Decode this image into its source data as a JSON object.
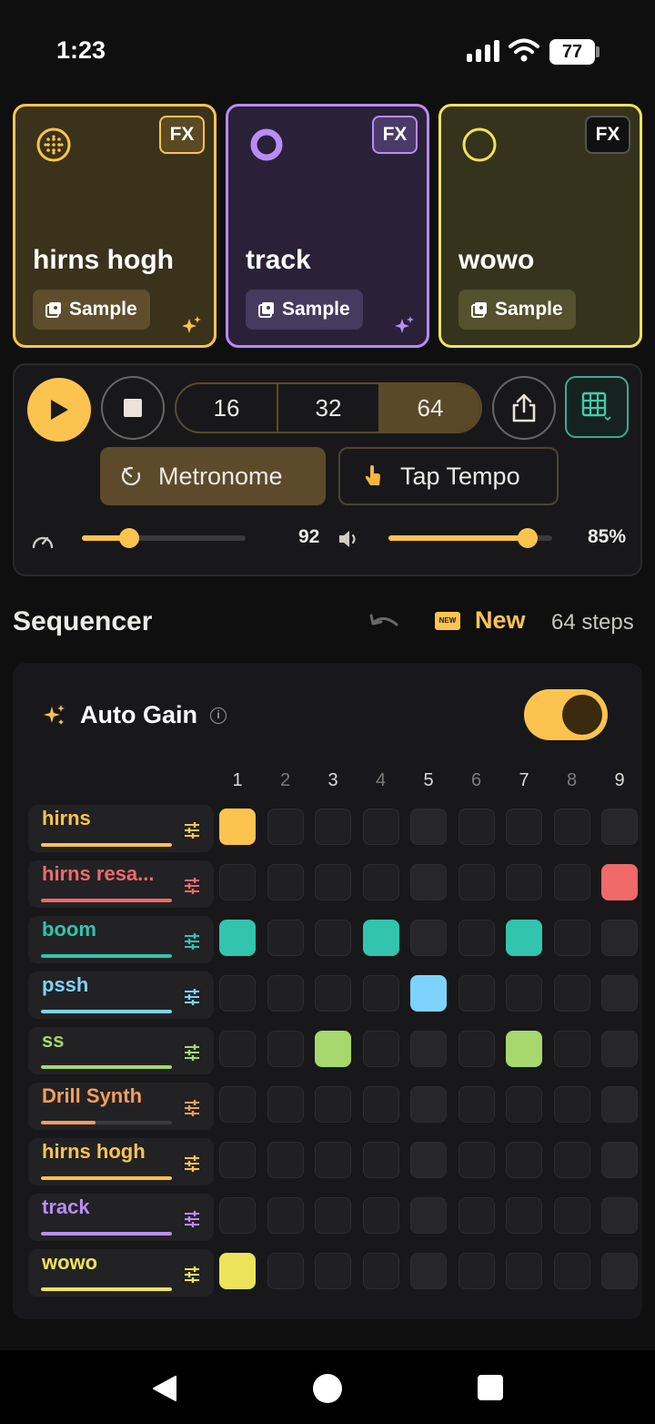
{
  "status_bar": {
    "time": "1:23",
    "battery": "77"
  },
  "tracks": [
    {
      "name": "hirns hogh",
      "fx_label": "FX",
      "sample_label": "Sample",
      "color": "#fcc44e",
      "bg": "#3b321b",
      "fx_bg": "#5a4a24",
      "chip_bg": "#5e4e2c",
      "icon": "dotted-circle-icon",
      "sparkle": true
    },
    {
      "name": "track",
      "fx_label": "FX",
      "sample_label": "Sample",
      "color": "#b98cf6",
      "bg": "#2a2138",
      "fx_bg": "#4a3a6a",
      "chip_bg": "#463a5e",
      "icon": "ring-icon",
      "sparkle": true
    },
    {
      "name": "wowo",
      "fx_label": "FX",
      "sample_label": "Sample",
      "color": "#ede45c",
      "bg": "#35331c",
      "fx_bg": "#111111",
      "chip_bg": "#55502d",
      "icon": "circle-outline-icon",
      "sparkle": false
    }
  ],
  "transport": {
    "step_options": [
      "16",
      "32",
      "64"
    ],
    "selected_steps": "64",
    "metronome_label": "Metronome",
    "tap_tempo_label": "Tap Tempo",
    "tempo": {
      "value": "92",
      "fraction": 0.29
    },
    "volume": {
      "value": "85%",
      "fraction": 0.85
    }
  },
  "sequencer": {
    "title": "Sequencer",
    "new_label": "New",
    "new_badge": "NEW",
    "steps_label": "64 steps",
    "auto_gain_label": "Auto Gain",
    "auto_gain_on": true,
    "step_numbers": [
      "1",
      "2",
      "3",
      "4",
      "5",
      "6",
      "7",
      "8",
      "9"
    ],
    "rows": [
      {
        "name": "hirns",
        "color": "#fcc44e",
        "level": 1.0,
        "active_steps": [
          1
        ]
      },
      {
        "name": "hirns resa...",
        "color": "#f06a6a",
        "level": 1.0,
        "active_steps": [
          9
        ]
      },
      {
        "name": "boom",
        "color": "#33c4ad",
        "level": 1.0,
        "active_steps": [
          1,
          4,
          7
        ]
      },
      {
        "name": "pssh",
        "color": "#7dd3fc",
        "level": 1.0,
        "active_steps": [
          5
        ]
      },
      {
        "name": "ss",
        "color": "#a6d86e",
        "level": 1.0,
        "active_steps": [
          3,
          7
        ]
      },
      {
        "name": "Drill Synth",
        "color": "#f59e5b",
        "level": 0.42,
        "active_steps": []
      },
      {
        "name": "hirns hogh",
        "color": "#fcc44e",
        "level": 1.0,
        "active_steps": []
      },
      {
        "name": "track",
        "color": "#b98cf6",
        "level": 1.0,
        "active_steps": []
      },
      {
        "name": "wowo",
        "color": "#ede45c",
        "level": 1.0,
        "active_steps": [
          1
        ]
      }
    ]
  }
}
